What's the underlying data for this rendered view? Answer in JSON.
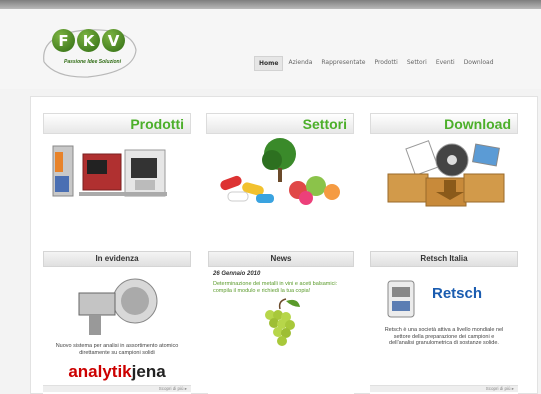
{
  "logo": {
    "letters": [
      "F",
      "K",
      "V"
    ],
    "tagline": "Passione Idee Soluzioni"
  },
  "nav": {
    "items": [
      "Home",
      "Azienda",
      "Rappresentate",
      "Prodotti",
      "Settori",
      "Eventi",
      "Download"
    ],
    "active": "Home"
  },
  "boxes": {
    "prodotti": {
      "title": "Prodotti"
    },
    "settori": {
      "title": "Settori"
    },
    "download": {
      "title": "Download"
    }
  },
  "evidenza": {
    "title": "In evidenza",
    "text": "Nuovo sistema per analisi in assortimento atomico direttamente su campioni solidi",
    "brand_part1": "analytik",
    "brand_part2": "jena",
    "more": "Scopri di più ▸"
  },
  "news": {
    "title": "News",
    "date": "26 Gennaio 2010",
    "text": "Determinazione dei metalli in vini e aceti balsamici: compila il modulo e richiedi la tua copia!"
  },
  "retsch": {
    "title": "Retsch Italia",
    "brand": "Retsch",
    "text": "Retsch è una società attiva a livello mondiale nel settore della preparazione dei campioni e dell'analisi granulometrica di sostanze solide.",
    "more": "Scopri di più ▸"
  },
  "colors": {
    "accent_green": "#4caf2a",
    "brand_red": "#cc0000",
    "retsch_blue": "#1a5cb0"
  }
}
